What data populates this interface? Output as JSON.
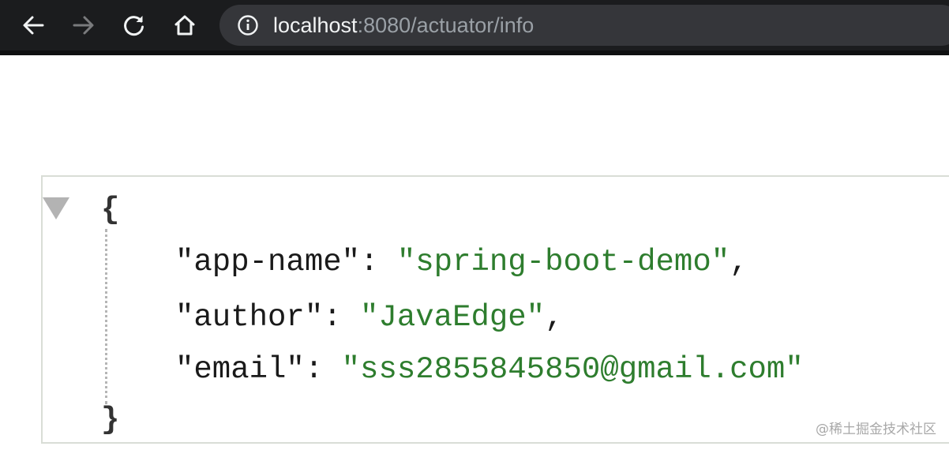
{
  "browser": {
    "nav": {
      "back_icon": "arrow-left-icon",
      "forward_icon": "arrow-right-icon",
      "reload_icon": "reload-icon",
      "home_icon": "home-icon"
    },
    "address_bar": {
      "info_icon": "info-icon",
      "host": "localhost",
      "path": ":8080/actuator/info"
    },
    "colors": {
      "toolbar_bg": "#1b1c1e",
      "omnibox_bg": "#35363a",
      "forward_disabled": "#7a7b7d"
    }
  },
  "json_viewer": {
    "toggle_icon": "collapse-triangle-icon",
    "open_brace": "{",
    "close_brace": "}",
    "entries": [
      {
        "key": "\"app-name\"",
        "separator": ": ",
        "value": "\"spring-boot-demo\"",
        "trailing": ","
      },
      {
        "key": "\"author\"",
        "separator": ": ",
        "value": "\"JavaEdge\"",
        "trailing": ","
      },
      {
        "key": "\"email\"",
        "separator": ": ",
        "value": "\"sss2855845850@gmail.com\"",
        "trailing": ""
      }
    ],
    "colors": {
      "string_value": "#2e7d2e",
      "key": "#1a1a1a"
    }
  },
  "watermark": {
    "text": "@稀土掘金技术社区"
  }
}
